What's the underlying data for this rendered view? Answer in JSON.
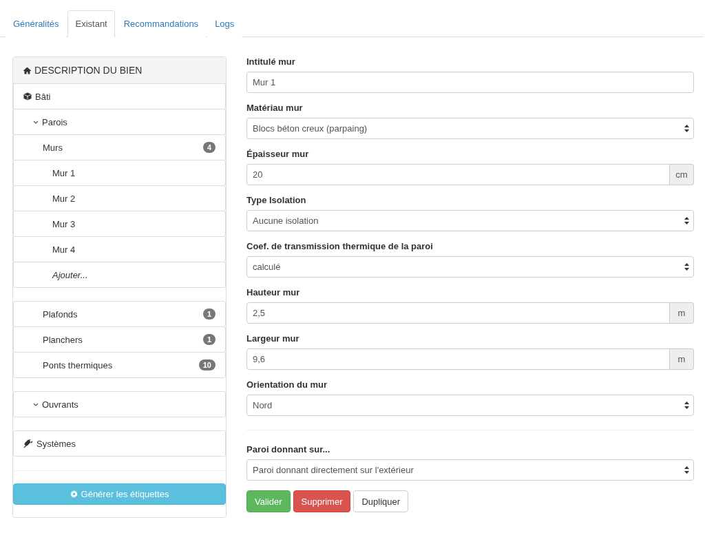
{
  "tabs": [
    {
      "label": "Généralités",
      "selected": false
    },
    {
      "label": "Existant",
      "selected": true
    },
    {
      "label": "Recommandations",
      "selected": false
    },
    {
      "label": "Logs",
      "selected": false
    }
  ],
  "sidebar": {
    "title": "DESCRIPTION DU BIEN",
    "items": [
      {
        "label": "Bâti",
        "children": [
          {
            "label": "Parois",
            "expanded": true,
            "children": [
              {
                "label": "Murs",
                "badge": "4",
                "children": [
                  {
                    "label": "Mur 1"
                  },
                  {
                    "label": "Mur 2"
                  },
                  {
                    "label": "Mur 3"
                  },
                  {
                    "label": "Mur 4"
                  },
                  {
                    "label": "Ajouter...",
                    "kind": "add"
                  }
                ]
              },
              {
                "label": "Plafonds",
                "badge": "1"
              },
              {
                "label": "Planchers",
                "badge": "1"
              },
              {
                "label": "Ponts thermiques",
                "badge": "10"
              }
            ]
          },
          {
            "label": "Ouvrants",
            "expanded": true
          }
        ]
      },
      {
        "label": "Systèmes"
      }
    ],
    "button": "Générer les étiquettes"
  },
  "form": {
    "fields": [
      {
        "kind": "text",
        "label": "Intitulé mur",
        "value": "Mur 1"
      },
      {
        "kind": "select",
        "label": "Matériau mur",
        "value": "Blocs béton creux (parpaing)"
      },
      {
        "kind": "text",
        "label": "Épaisseur mur",
        "value": "20",
        "unit": "cm"
      },
      {
        "kind": "select",
        "label": "Type Isolation",
        "value": "Aucune isolation"
      },
      {
        "kind": "select",
        "label": "Coef. de transmission thermique de la paroi",
        "value": "calculé"
      },
      {
        "kind": "text",
        "label": "Hauteur mur",
        "value": "2,5",
        "unit": "m"
      },
      {
        "kind": "text",
        "label": "Largeur mur",
        "value": "9,6",
        "unit": "m"
      },
      {
        "kind": "select",
        "label": "Orientation du mur",
        "value": "Nord"
      },
      {
        "kind": "select",
        "label": "Paroi donnant sur...",
        "value": "Paroi donnant directement sur l'extérieur",
        "separated": true
      }
    ],
    "buttons": [
      {
        "label": "Valider",
        "kind": "success"
      },
      {
        "label": "Supprimer",
        "kind": "danger"
      },
      {
        "label": "Dupliquer",
        "kind": "default"
      }
    ]
  }
}
